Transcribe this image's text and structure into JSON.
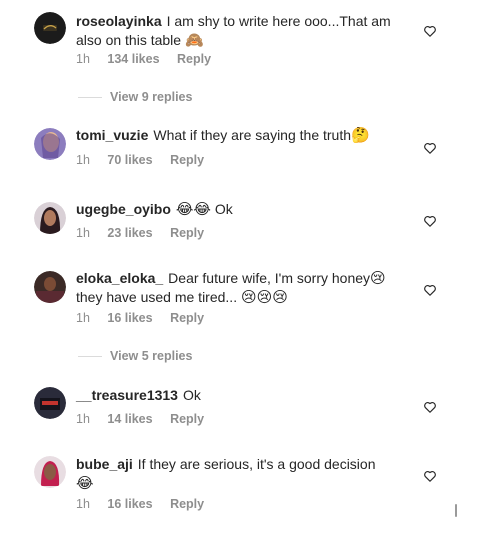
{
  "comments": [
    {
      "username": "roseolayinka",
      "text": "I am shy to write here ooo...That am also on this table",
      "emoji": "🙈",
      "time": "1h",
      "likes": "134 likes",
      "reply": "Reply",
      "view_replies": "View 9 replies"
    },
    {
      "username": "tomi_vuzie",
      "text": "What if they are saying the truth",
      "emoji": "🤔",
      "time": "1h",
      "likes": "70 likes",
      "reply": "Reply"
    },
    {
      "username": "ugegbe_oyibo",
      "text": "Ok",
      "emoji": "😂😂",
      "time": "1h",
      "likes": "23 likes",
      "reply": "Reply"
    },
    {
      "username": "eloka_eloka_",
      "text": "Dear future wife, I'm sorry honey",
      "emoji": "😢",
      "text2": "they have used me tired...",
      "emoji2": "😢😢😢",
      "time": "1h",
      "likes": "16 likes",
      "reply": "Reply",
      "view_replies": "View 5 replies"
    },
    {
      "username": "__treasure1313",
      "text": "Ok",
      "time": "1h",
      "likes": "14 likes",
      "reply": "Reply"
    },
    {
      "username": "bube_aji",
      "text": "If they are serious, it's a good decision",
      "emoji": "😂",
      "time": "1h",
      "likes": "16 likes",
      "reply": "Reply"
    }
  ],
  "icons": {
    "like": "heart-outline-icon"
  },
  "colors": {
    "text": "#262626",
    "muted": "#8e8e8e",
    "divider": "#dbdbdb"
  }
}
